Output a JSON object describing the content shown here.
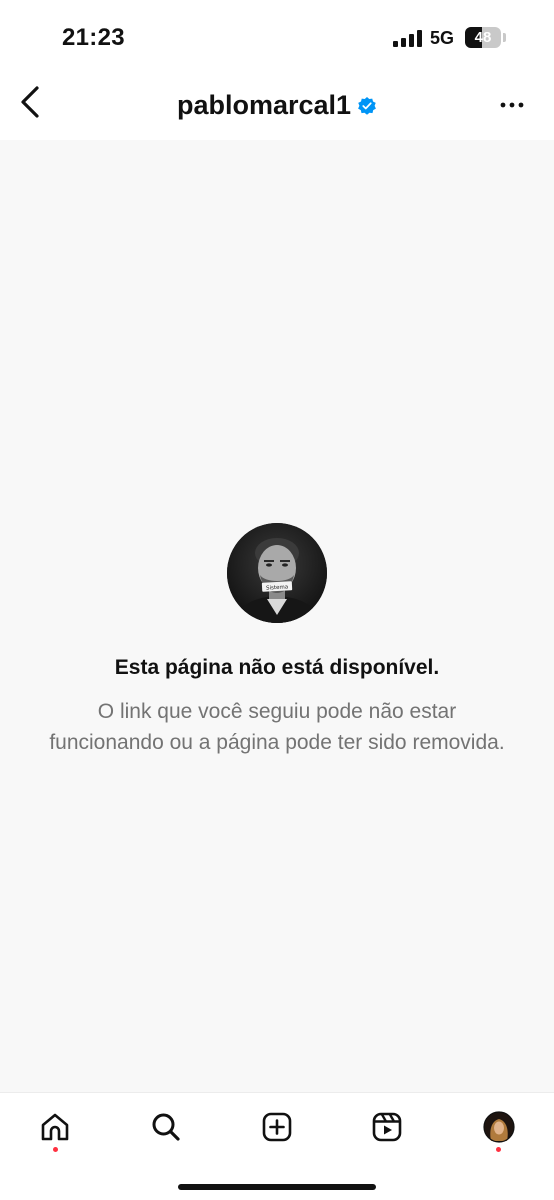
{
  "status_bar": {
    "time": "21:23",
    "network": "5G",
    "battery_percent": "48",
    "battery_level": 0.48,
    "signal_bars": 4
  },
  "header": {
    "username": "pablomarcal1",
    "verified": true,
    "back_icon": "chevron-left-icon",
    "more_icon": "more-horizontal-icon"
  },
  "error": {
    "title": "Esta página não está disponível.",
    "message": "O link que você seguiu pode não estar funcionando ou a página pode ter sido removida."
  },
  "profile_photo": {
    "caption_text": "Sistema"
  },
  "tabbar": {
    "items": [
      {
        "icon": "home-icon",
        "notification_dot": true
      },
      {
        "icon": "search-icon",
        "notification_dot": false
      },
      {
        "icon": "create-icon",
        "notification_dot": false
      },
      {
        "icon": "reels-icon",
        "notification_dot": false
      },
      {
        "icon": "profile-avatar-icon",
        "notification_dot": true
      }
    ]
  },
  "colors": {
    "verified_blue": "#0095f6",
    "notification_red": "#ff3040",
    "content_background": "#f8f8f8",
    "secondary_text": "#737373"
  }
}
